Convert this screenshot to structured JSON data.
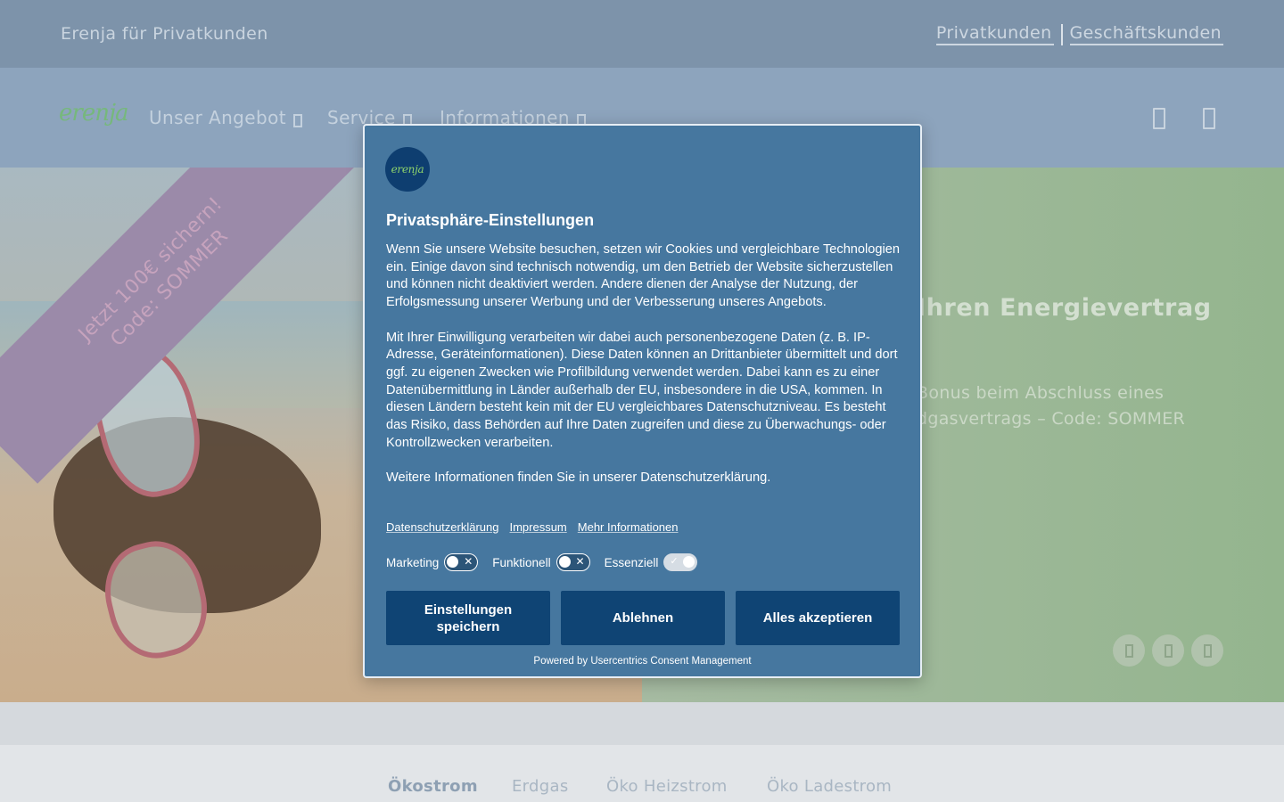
{
  "topbar": {
    "brandline": "Erenja für Privatkunden",
    "segments": [
      "Privatkunden",
      "Geschäftskunden"
    ]
  },
  "nav": {
    "logo": "erenja",
    "items": [
      {
        "label": "Unser Angebot"
      },
      {
        "label": "Service"
      },
      {
        "label": "Informationen"
      }
    ],
    "icons": [
      "search-icon",
      "user-icon"
    ]
  },
  "hero": {
    "ribbon_line1": "Jetzt 100€ sichern!",
    "ribbon_line2": "Code: SOMMER",
    "headline": "Ihren Energievertrag",
    "subline_1": "Bonus beim Abschluss eines",
    "subline_2": "dgasvertrags – Code: SOMMER",
    "controls": [
      "prev-icon",
      "pause-icon",
      "next-icon"
    ]
  },
  "tabs": [
    "Ökostrom",
    "Erdgas",
    "Öko Heizstrom",
    "Öko Ladestrom"
  ],
  "consent": {
    "logo": "erenja",
    "title": "Privatsphäre-Einstellungen",
    "para1": "Wenn Sie unsere Website besuchen, setzen wir Cookies und vergleichbare Technologien ein. Einige davon sind technisch notwendig, um den Betrieb der Website sicherzustellen und können nicht deaktiviert werden. Andere dienen der Analyse der Nutzung, der Erfolgsmessung unserer Werbung und der Verbesserung unseres Angebots.",
    "para2": "Mit Ihrer Einwilligung verarbeiten wir dabei auch personenbezogene Daten (z. B. IP-Adresse, Geräteinformationen). Diese Daten können an Drittanbieter übermittelt und dort ggf. zu eigenen Zwecken wie Profilbildung verwendet werden. Dabei kann es zu einer Datenübermittlung in Länder außerhalb der EU, insbesondere in die USA, kommen. In diesen Ländern besteht kein mit der EU vergleichbares Datenschutzniveau. Es besteht das Risiko, dass Behörden auf Ihre Daten zugreifen und diese zu Überwachungs- oder Kontrollzwecken verarbeiten.",
    "para3": "Weitere Informationen finden Sie in unserer Datenschutzerklärung.",
    "links": [
      "Datenschutzerklärung",
      "Impressum",
      "Mehr Informationen"
    ],
    "toggles": [
      {
        "label": "Marketing",
        "on": false
      },
      {
        "label": "Funktionell",
        "on": false
      },
      {
        "label": "Essenziell",
        "on": true
      }
    ],
    "buttons": {
      "save": "Einstellungen speichern",
      "decline": "Ablehnen",
      "accept": "Alles akzeptieren"
    },
    "powered": "Powered by Usercentrics Consent Management"
  }
}
